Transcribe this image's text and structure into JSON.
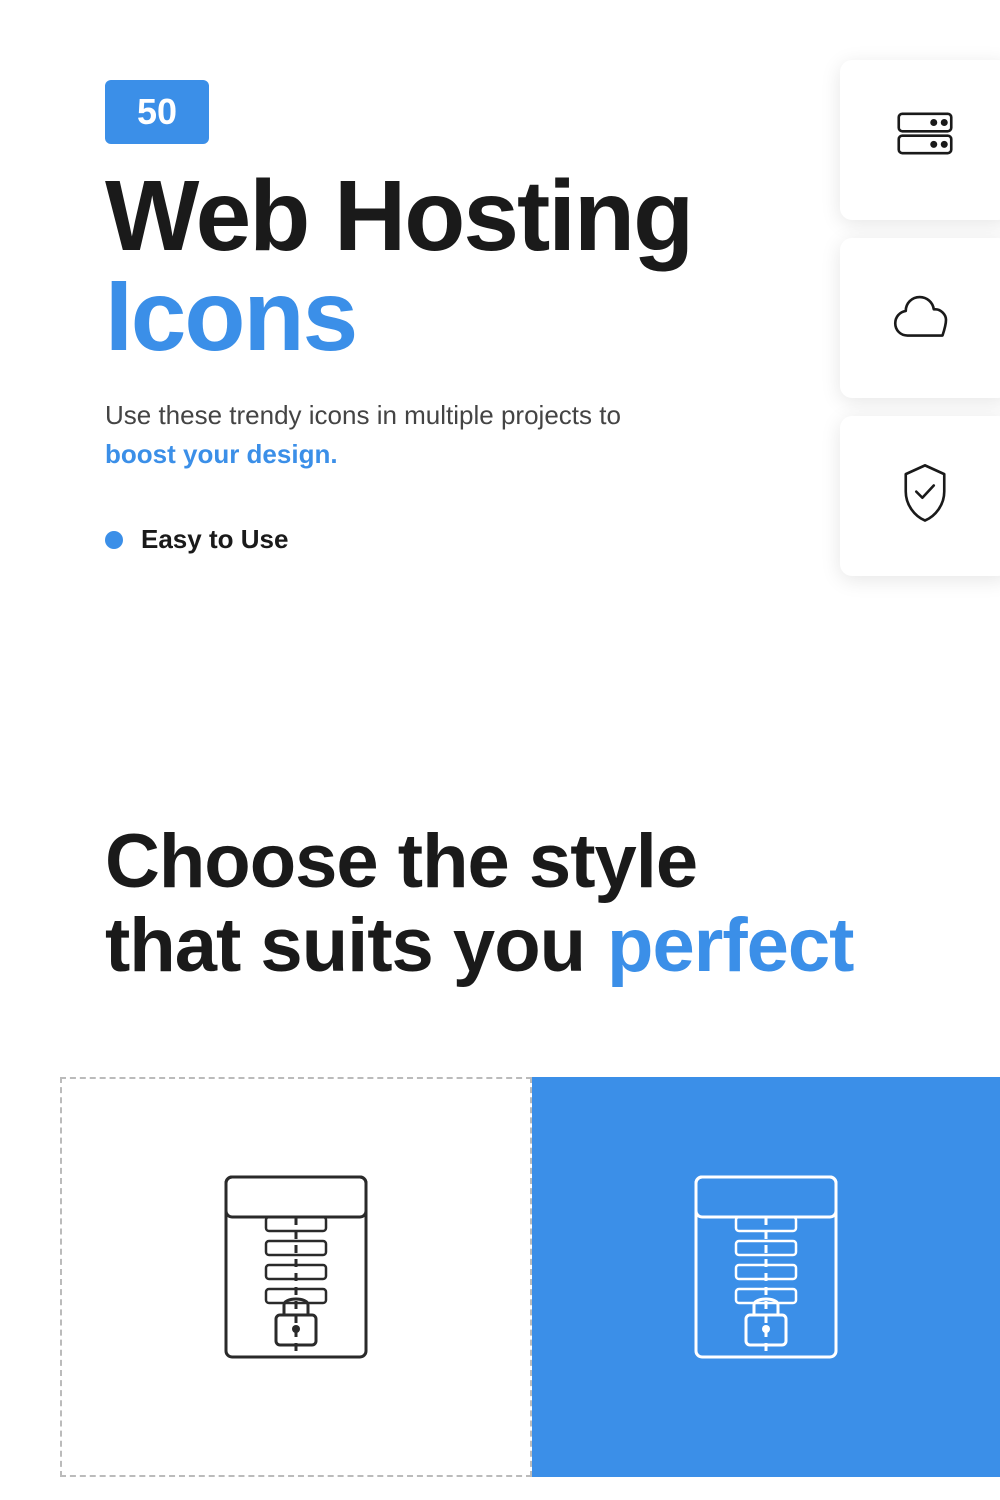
{
  "badge": {
    "number": "50"
  },
  "hero": {
    "title_line1": "Web Hosting",
    "title_line2": "Icons",
    "description_text": "Use these trendy icons in multiple projects to ",
    "description_link": "boost your design.",
    "bullet_items": [
      {
        "label": "Easy to Use"
      }
    ]
  },
  "choose_section": {
    "line1": "Choose the style",
    "line2_static": "that suits you",
    "line2_blue": "perfect"
  },
  "colors": {
    "blue": "#3b8fe8",
    "black": "#1a1a1a",
    "white": "#ffffff"
  }
}
